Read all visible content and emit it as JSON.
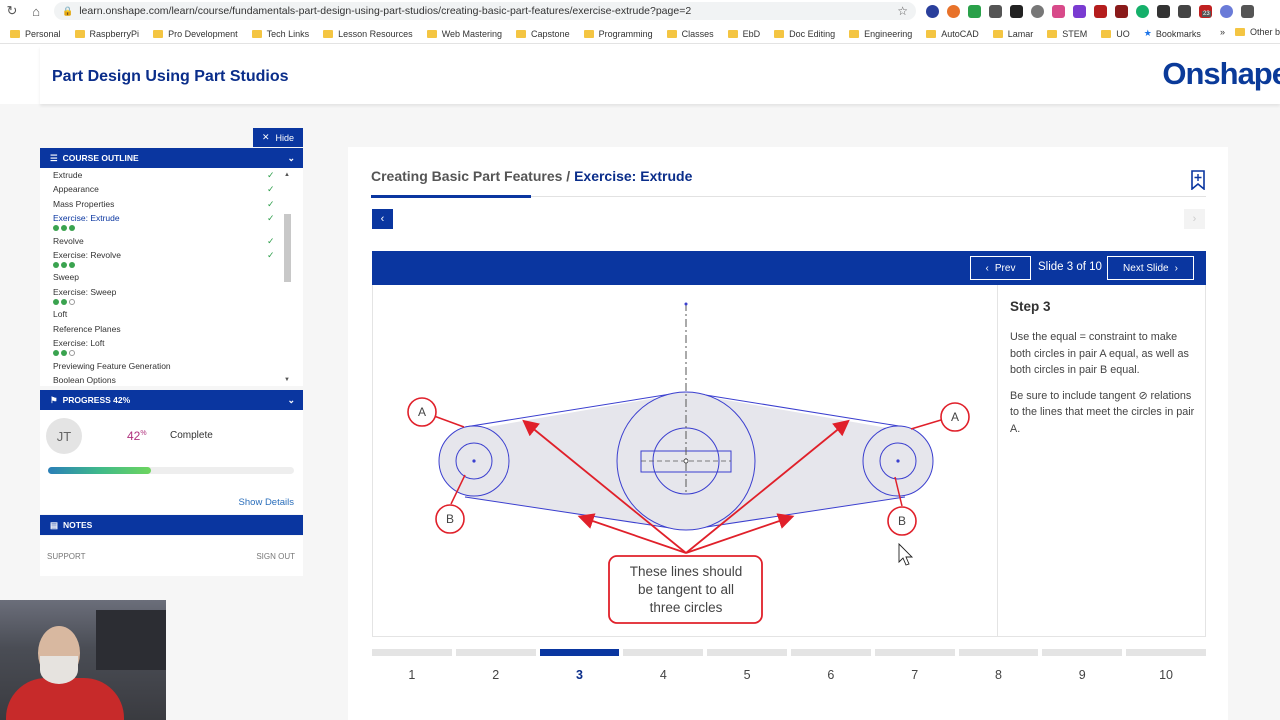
{
  "browser": {
    "url": "learn.onshape.com/learn/course/fundamentals-part-design-using-part-studios/creating-basic-part-features/exercise-extrude?page=2",
    "extension_badge": "23",
    "bookmarks": [
      "Personal",
      "RaspberryPi",
      "Pro Development",
      "Tech Links",
      "Lesson Resources",
      "Web Mastering",
      "Capstone",
      "Programming",
      "Classes",
      "EbD",
      "Doc Editing",
      "Engineering",
      "AutoCAD",
      "Lamar",
      "STEM",
      "UO"
    ],
    "bookmarks_star": "Bookmarks",
    "bookmarks_more": "»",
    "bookmarks_other": "Other b"
  },
  "header": {
    "course_title": "Part Design Using Part Studios",
    "brand": "Onshape"
  },
  "sidebar": {
    "hide_label": "Hide",
    "outline_title": "COURSE OUTLINE",
    "outline_items": [
      {
        "label": "Extrude",
        "done": true
      },
      {
        "label": "Appearance",
        "done": true
      },
      {
        "label": "Mass Properties",
        "done": true
      },
      {
        "label": "Exercise: Extrude",
        "done": true,
        "active": true,
        "dots": [
          1,
          1,
          1
        ]
      },
      {
        "label": "Revolve",
        "done": true
      },
      {
        "label": "Exercise: Revolve",
        "done": true,
        "dots": [
          1,
          1,
          1
        ]
      },
      {
        "label": "Sweep",
        "done": false
      },
      {
        "label": "Exercise: Sweep",
        "done": false,
        "dots": [
          1,
          1,
          0
        ]
      },
      {
        "label": "Loft",
        "done": false
      },
      {
        "label": "Reference Planes",
        "done": false
      },
      {
        "label": "Exercise: Loft",
        "done": false,
        "dots": [
          1,
          1,
          0
        ]
      },
      {
        "label": "Previewing Feature Generation",
        "done": false
      },
      {
        "label": "Boolean Options",
        "done": false
      }
    ],
    "progress_title": "PROGRESS 42%",
    "avatar_initials": "JT",
    "progress_value": "42",
    "progress_unit": "%",
    "progress_fraction": 0.42,
    "complete_label": "Complete",
    "show_details": "Show Details",
    "notes_title": "NOTES",
    "support": "SUPPORT",
    "sign_out": "SIGN OUT"
  },
  "lesson": {
    "breadcrumb_parent": "Creating Basic Part Features /",
    "breadcrumb_current": "Exercise: Extrude",
    "prev_label": "Prev",
    "slide_counter": "Slide 3 of 10",
    "next_label": "Next Slide",
    "step_title": "Step 3",
    "step_p1": "Use the equal  =  constraint to make both circles in pair A equal, as well as both circles in pair B equal.",
    "step_p2": "Be sure to include tangent ⊘ relations to the lines that meet the circles in pair A.",
    "callout_A": "A",
    "callout_B": "B",
    "callout_text": [
      "These lines should",
      "be tangent to all",
      "three circles"
    ],
    "pages": [
      "1",
      "2",
      "3",
      "4",
      "5",
      "6",
      "7",
      "8",
      "9",
      "10"
    ],
    "current_page": 3
  },
  "colors": {
    "primary": "#0a36a0",
    "sketch_blue": "#3b3fcf",
    "annotation_red": "#e0202a",
    "check_green": "#2e9e4b"
  }
}
